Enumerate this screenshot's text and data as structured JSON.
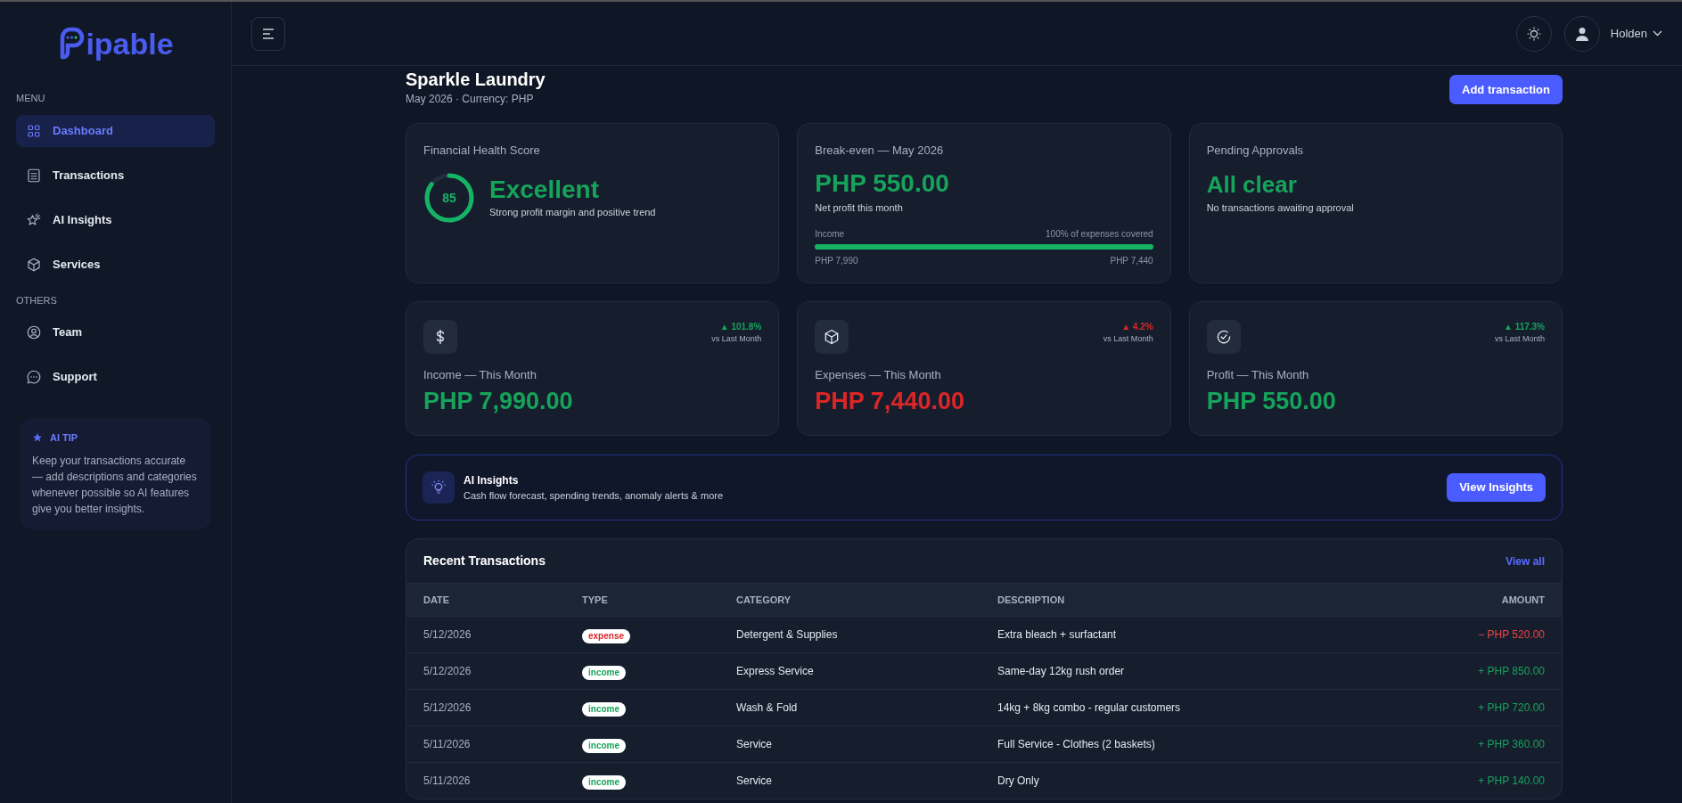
{
  "brand": {
    "name": "ipable"
  },
  "sidebar": {
    "sections": [
      {
        "title": "MENU",
        "items": [
          {
            "label": "Dashboard",
            "selected": true
          },
          {
            "label": "Transactions",
            "selected": false
          },
          {
            "label": "AI Insights",
            "selected": false
          },
          {
            "label": "Services",
            "selected": false
          }
        ]
      },
      {
        "title": "OTHERS",
        "items": [
          {
            "label": "Team",
            "selected": false
          },
          {
            "label": "Support",
            "selected": false
          }
        ]
      }
    ],
    "tip": {
      "title": "AI TIP",
      "text": "Keep your transactions accurate — add descriptions and categories whenever possible so AI features give you better insights."
    }
  },
  "header": {
    "user": "Holden"
  },
  "page": {
    "title": "Sparkle Laundry",
    "subtitle": "May 2026 · Currency: PHP",
    "action": "Add transaction"
  },
  "health": {
    "title": "Financial Health Score",
    "score": "85",
    "level": 0.85,
    "rating": "Excellent",
    "note": "Strong profit margin and positive trend"
  },
  "breakeven": {
    "title": "Break-even — May 2026",
    "value": "PHP 550.00",
    "note": "Net profit this month",
    "left_label": "Income",
    "right_label": "100% of expenses covered",
    "level": 1,
    "left_amount": "PHP 7,990",
    "right_amount": "PHP 7,440"
  },
  "approvals": {
    "title": "Pending Approvals",
    "value": "All clear",
    "note": "No transactions awaiting approval"
  },
  "stats": [
    {
      "kind": "income",
      "change": "▲ 101.8%",
      "compare": "vs Last Month",
      "label": "Income — This Month",
      "value": "PHP 7,990.00"
    },
    {
      "kind": "expense",
      "change": "▲ 4.2%",
      "compare": "vs Last Month",
      "label": "Expenses — This Month",
      "value": "PHP 7,440.00"
    },
    {
      "kind": "profit",
      "change": "▲ 117.3%",
      "compare": "vs Last Month",
      "label": "Profit — This Month",
      "value": "PHP 550.00"
    }
  ],
  "insights": {
    "title": "AI Insights",
    "text": "Cash flow forecast, spending trends, anomaly alerts & more",
    "action": "View Insights"
  },
  "transactions": {
    "title": "Recent Transactions",
    "link": "View all",
    "columns": [
      "DATE",
      "TYPE",
      "CATEGORY",
      "DESCRIPTION",
      "AMOUNT"
    ],
    "rows": [
      {
        "date": "5/12/2026",
        "type": "expense",
        "category": "Detergent & Supplies",
        "description": "Extra bleach + surfactant",
        "amount": "− PHP 520.00"
      },
      {
        "date": "5/12/2026",
        "type": "income",
        "category": "Express Service",
        "description": "Same-day 12kg rush order",
        "amount": "+ PHP 850.00"
      },
      {
        "date": "5/12/2026",
        "type": "income",
        "category": "Wash & Fold",
        "description": "14kg + 8kg combo - regular customers",
        "amount": "+ PHP 720.00"
      },
      {
        "date": "5/11/2026",
        "type": "income",
        "category": "Service",
        "description": "Full Service - Clothes (2 baskets)",
        "amount": "+ PHP 360.00"
      },
      {
        "date": "5/11/2026",
        "type": "income",
        "category": "Service",
        "description": "Dry Only",
        "amount": "+ PHP 140.00"
      }
    ]
  }
}
